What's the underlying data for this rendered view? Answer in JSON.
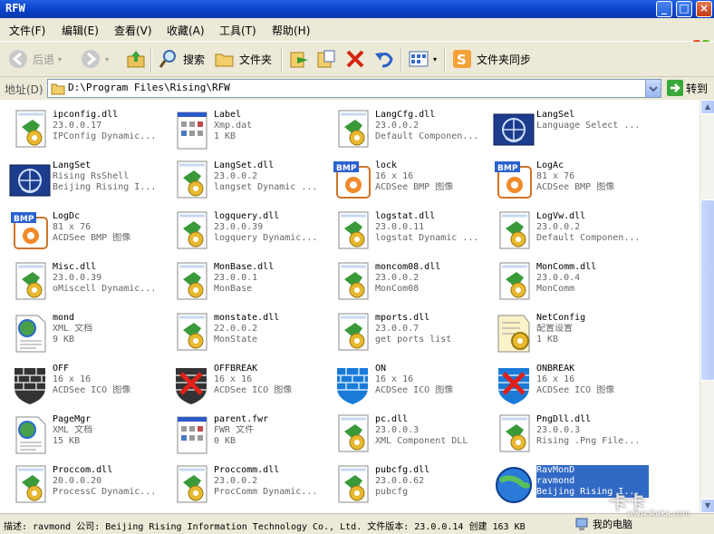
{
  "window": {
    "title": "RFW",
    "min": "_",
    "max": "□",
    "close": "×"
  },
  "menu": [
    "文件(F)",
    "编辑(E)",
    "查看(V)",
    "收藏(A)",
    "工具(T)",
    "帮助(H)"
  ],
  "toolbar": {
    "back": "后退",
    "search": "搜索",
    "folders": "文件夹",
    "sync": "文件夹同步"
  },
  "address": {
    "label": "地址(D)",
    "path": "D:\\Program Files\\Rising\\RFW",
    "go": "转到"
  },
  "items": [
    {
      "name": "ipconfig.dll",
      "l1": "23.0.0.17",
      "l2": "IPConfig Dynamic...",
      "icon": "dll-icon"
    },
    {
      "name": "Label",
      "l1": "Xmp.dat",
      "l2": "1 KB",
      "icon": "dat-file-icon"
    },
    {
      "name": "LangCfg.dll",
      "l1": "23.0.0.2",
      "l2": "Default Componen...",
      "icon": "dll-icon"
    },
    {
      "name": "LangSel",
      "l1": "Language Select ...",
      "l2": "",
      "icon": "rising-app-icon"
    },
    {
      "name": "LangSet",
      "l1": "Rising RsShell",
      "l2": "Beijing Rising I...",
      "icon": "rising-app-icon"
    },
    {
      "name": "LangSet.dll",
      "l1": "23.0.0.2",
      "l2": "langset Dynamic ...",
      "icon": "dll-icon"
    },
    {
      "name": "lock",
      "l1": "16 x 16",
      "l2": "ACDSee BMP 图像",
      "icon": "bmp-icon"
    },
    {
      "name": "LogAc",
      "l1": "81 x 76",
      "l2": "ACDSee BMP 图像",
      "icon": "bmp-icon"
    },
    {
      "name": "LogDc",
      "l1": "81 x 76",
      "l2": "ACDSee BMP 图像",
      "icon": "bmp-icon"
    },
    {
      "name": "logquery.dll",
      "l1": "23.0.0.39",
      "l2": "logquery Dynamic...",
      "icon": "dll-icon"
    },
    {
      "name": "logstat.dll",
      "l1": "23.0.0.11",
      "l2": "logstat Dynamic ...",
      "icon": "dll-icon"
    },
    {
      "name": "LogVw.dll",
      "l1": "23.0.0.2",
      "l2": "Default Componen...",
      "icon": "dll-icon"
    },
    {
      "name": "Misc.dll",
      "l1": "23.0.0.39",
      "l2": "oMiscell Dynamic...",
      "icon": "dll-icon"
    },
    {
      "name": "MonBase.dll",
      "l1": "23.0.0.1",
      "l2": "MonBase",
      "icon": "dll-icon"
    },
    {
      "name": "moncom08.dll",
      "l1": "23.0.0.2",
      "l2": "MonCom08",
      "icon": "dll-icon"
    },
    {
      "name": "MonComm.dll",
      "l1": "23.0.0.4",
      "l2": "MonComm",
      "icon": "dll-icon"
    },
    {
      "name": "mond",
      "l1": "XML 文档",
      "l2": "9 KB",
      "icon": "xml-icon"
    },
    {
      "name": "monstate.dll",
      "l1": "22.0.0.2",
      "l2": "MonState",
      "icon": "dll-icon"
    },
    {
      "name": "mports.dll",
      "l1": "23.0.0.7",
      "l2": "get ports list",
      "icon": "dll-icon"
    },
    {
      "name": "NetConfig",
      "l1": "配置设置",
      "l2": "1 KB",
      "icon": "config-icon"
    },
    {
      "name": "OFF",
      "l1": "16 x 16",
      "l2": "ACDSee ICO 图像",
      "icon": "firewall-off-icon"
    },
    {
      "name": "OFFBREAK",
      "l1": "16 x 16",
      "l2": "ACDSee ICO 图像",
      "icon": "firewall-offbreak-icon"
    },
    {
      "name": "ON",
      "l1": "16 x 16",
      "l2": "ACDSee ICO 图像",
      "icon": "firewall-on-icon"
    },
    {
      "name": "ONBREAK",
      "l1": "16 x 16",
      "l2": "ACDSee ICO 图像",
      "icon": "firewall-onbreak-icon"
    },
    {
      "name": "PageMgr",
      "l1": "XML 文档",
      "l2": "15 KB",
      "icon": "xml-icon"
    },
    {
      "name": "parent.fwr",
      "l1": "FWR 文件",
      "l2": "0 KB",
      "icon": "dat-file-icon"
    },
    {
      "name": "pc.dll",
      "l1": "23.0.0.3",
      "l2": "XML Component DLL",
      "icon": "dll-icon"
    },
    {
      "name": "PngDll.dll",
      "l1": "23.0.0.3",
      "l2": "Rising .Png File...",
      "icon": "dll-icon"
    },
    {
      "name": "Proccom.dll",
      "l1": "20.0.0.20",
      "l2": "ProcessC Dynamic...",
      "icon": "dll-icon"
    },
    {
      "name": "Proccomm.dll",
      "l1": "23.0.0.2",
      "l2": "ProcComm Dynamic...",
      "icon": "dll-icon"
    },
    {
      "name": "pubcfg.dll",
      "l1": "23.0.0.62",
      "l2": "pubcfg",
      "icon": "dll-icon"
    },
    {
      "name": "RavMonD",
      "l1": "ravmond",
      "l2": "Beijing Rising I...",
      "icon": "ravmond-globe-icon"
    }
  ],
  "status": {
    "text": "描述: ravmond 公司: Beijing Rising Information Technology Co., Ltd. 文件版本: 23.0.0.14 创建 163 KB",
    "computer": "我的电脑"
  },
  "watermark": {
    "text": "卡卡",
    "url": "www.ikaka.com"
  },
  "colors": {
    "selection": "#316ac5",
    "title": "#0a3fc6",
    "chrome": "#ece9d8"
  }
}
